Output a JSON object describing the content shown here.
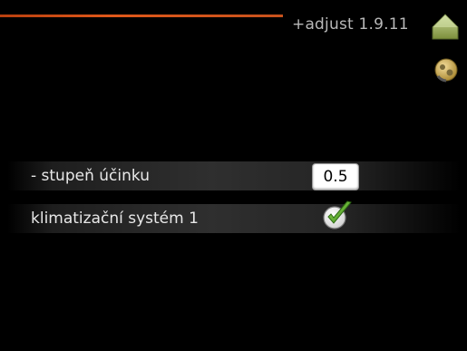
{
  "header": {
    "menu_title": "+adjust 1.9.11",
    "home_icon": "home-icon",
    "settings_icon": "settings-icon",
    "accent_color": "#e0581a"
  },
  "rows": [
    {
      "label": "- stupeň účinku",
      "value": "0.5"
    },
    {
      "label": "klimatizační systém 1",
      "checked": true,
      "icon": "checkmark-icon"
    }
  ]
}
